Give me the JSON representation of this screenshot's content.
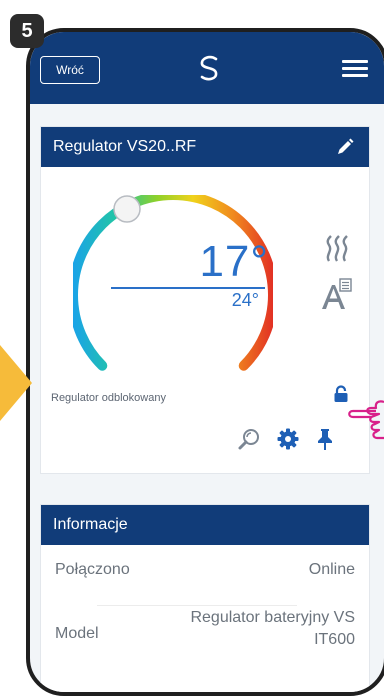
{
  "step": "5",
  "topbar": {
    "back_label": "Wróć",
    "logo_icon": "swirl-logo-icon",
    "menu_icon": "hamburger-menu-icon"
  },
  "device_card": {
    "title": "Regulator VS20..RF",
    "edit_icon": "pencil-icon",
    "current_temp": "17°",
    "set_temp": "24°",
    "mode_icons": [
      "heat-waves-icon",
      "auto-mode-icon"
    ],
    "status": "Regulator odblokowany",
    "lock_icon": "padlock-icon",
    "actions": [
      "magnifier-icon",
      "gear-icon",
      "pin-icon"
    ]
  },
  "info_card": {
    "title": "Informacje",
    "rows": [
      {
        "label": "Połączono",
        "value": "Online"
      },
      {
        "label": "Model",
        "value": "Regulator bateryjny VS",
        "value_cont": "IT600"
      }
    ]
  },
  "colors": {
    "primary": "#113c79",
    "temp_blue": "#2a70c8",
    "accent_yellow": "#f6bb3a",
    "pointer_pink": "#d8208a"
  }
}
